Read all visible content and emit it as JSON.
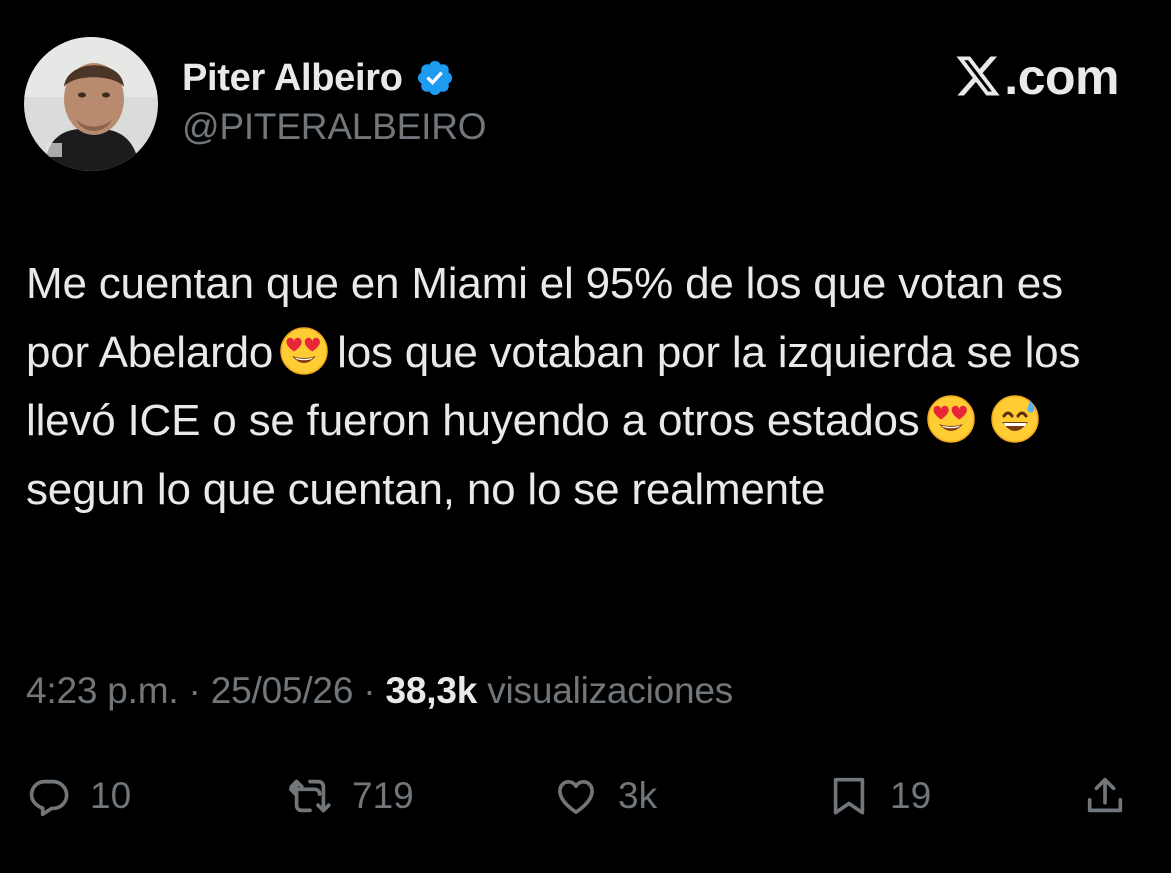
{
  "author": {
    "display_name": "Piter Albeiro",
    "handle": "@PITERALBEIRO",
    "verified": true,
    "verified_color": "#1d9bf0"
  },
  "brand": {
    "label": ".com",
    "logo_icon": "x-logo-icon"
  },
  "post": {
    "text_segments": [
      "Me cuentan que en Miami el 95% de los que votan es por Abelardo",
      "los que votaban por la izquierda se los llevó ICE o se fueron huyendo a otros estados",
      "segun lo que cuentan, no lo se realmente"
    ],
    "emojis": [
      "smiling-face-with-heart-eyes",
      "smiling-face-with-heart-eyes",
      "grinning-face-with-sweat"
    ]
  },
  "meta": {
    "time": "4:23 p.m.",
    "separator": "·",
    "date": "25/05/26",
    "views_count": "38,3k",
    "views_label": "visualizaciones"
  },
  "actions": {
    "replies": "10",
    "reposts": "719",
    "likes": "3k",
    "bookmarks": "19"
  },
  "colors": {
    "background": "#000000",
    "primary_text": "#e7e9ea",
    "secondary_text": "#71767b",
    "accent": "#1d9bf0"
  }
}
